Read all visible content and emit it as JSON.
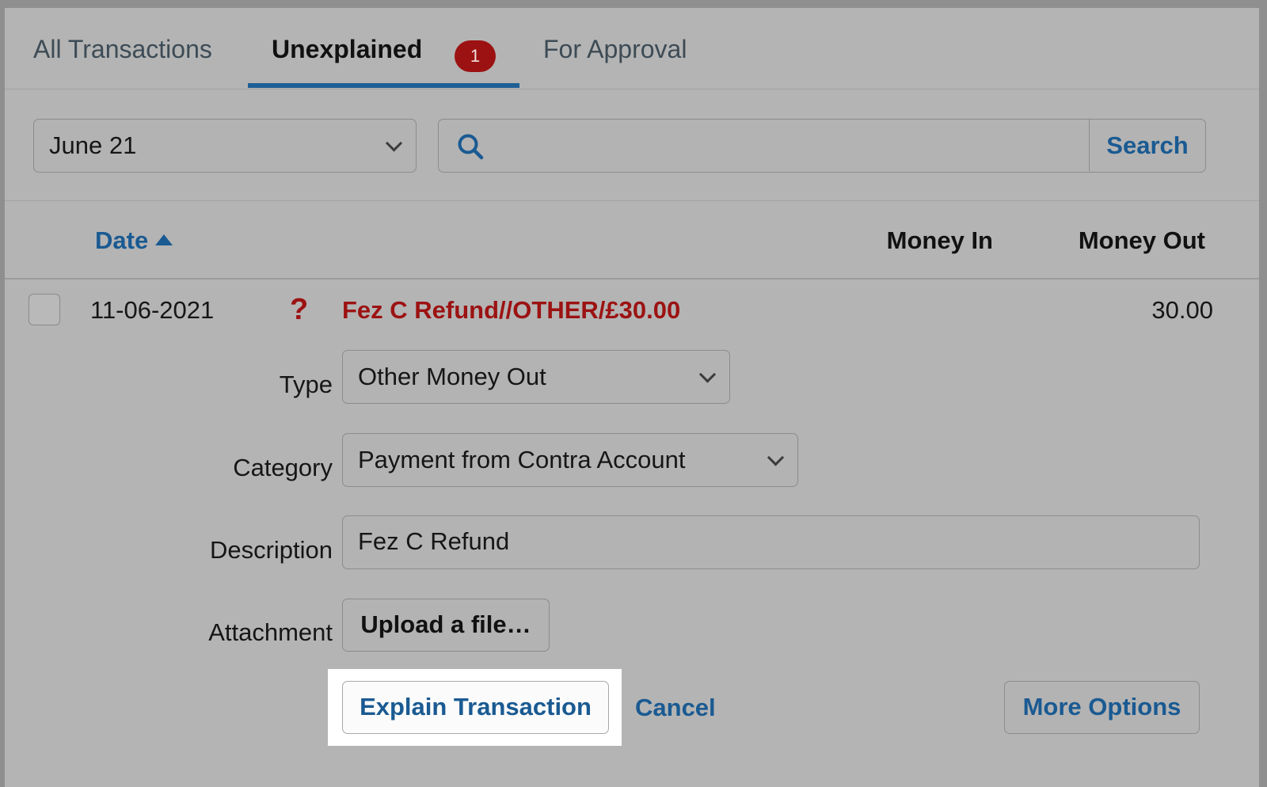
{
  "tabs": [
    {
      "label": "All Transactions"
    },
    {
      "label": "Unexplained",
      "badge": "1"
    },
    {
      "label": "For Approval"
    }
  ],
  "active_tab": "Unexplained",
  "filter": {
    "month_selected": "June 21",
    "search_placeholder": "",
    "search_button": "Search"
  },
  "table": {
    "headers": {
      "date": "Date",
      "money_in": "Money In",
      "money_out": "Money Out"
    },
    "sort": {
      "column": "Date",
      "direction": "ascending"
    }
  },
  "transaction": {
    "date": "11-06-2021",
    "status_icon": "?",
    "description": "Fez C Refund//OTHER/£30.00",
    "money_out": "30.00",
    "form": {
      "type_label": "Type",
      "type_value": "Other Money Out",
      "category_label": "Category",
      "category_value": "Payment from Contra Account",
      "description_label": "Description",
      "description_value": "Fez C Refund",
      "attachment_label": "Attachment",
      "upload_button": "Upload a file…"
    },
    "actions": {
      "explain": "Explain Transaction",
      "cancel": "Cancel",
      "more": "More Options"
    }
  },
  "colors": {
    "accent": "#1a5a92",
    "alert": "#9c1212",
    "highlight": "#ffffff"
  }
}
